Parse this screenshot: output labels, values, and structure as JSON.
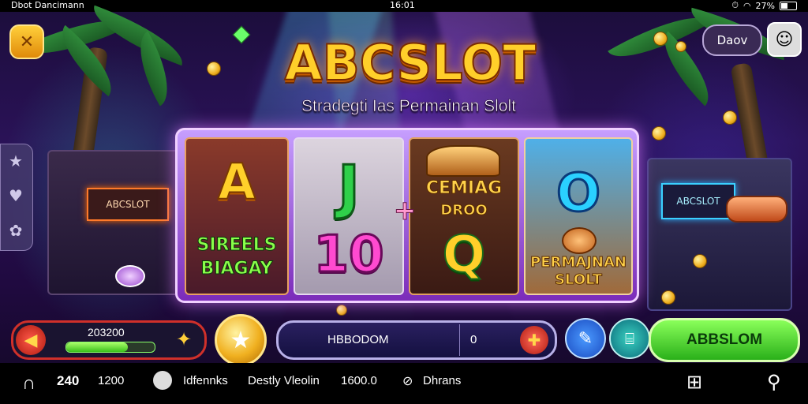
{
  "status_bar": {
    "left_text": "Dbot Dancimann",
    "time": "16:01",
    "battery": "27%"
  },
  "header": {
    "title": "ABCSLOT",
    "subtitle": "Stradegti  Ias Permainan Slolt",
    "menu_label": "Daov"
  },
  "machines": {
    "left_sign": "ABCSLOT",
    "right_sign": "ABCSLOT"
  },
  "reels": [
    {
      "top": "A",
      "bottom_line1": "SIREELS",
      "bottom_line2": "BIAGAY"
    },
    {
      "top": "J",
      "bottom": "10"
    },
    {
      "top_line1": "CEMIAG",
      "top_line2": "DROO",
      "bottom": "Q"
    },
    {
      "top": "O",
      "bottom_line1": "PERMAJNAN",
      "bottom_line2": "SLOLT"
    }
  ],
  "controls": {
    "bet_value": "203200",
    "bet_progress": 0.7,
    "balance_label": "HBBODOM",
    "balance_value": "0",
    "play_label": "ABBSLOM"
  },
  "bottom_nav": {
    "count_a": "240",
    "count_b": "1200",
    "item_1": "Idfennks",
    "item_2": "Destly Vleolin",
    "item_3": "1600.0",
    "item_4": "Dhrans"
  },
  "colors": {
    "title_gold": "#ffcf2a",
    "accent_green": "#2ab01a",
    "accent_purple": "#7a2ab8",
    "alert_red": "#d0302a"
  }
}
